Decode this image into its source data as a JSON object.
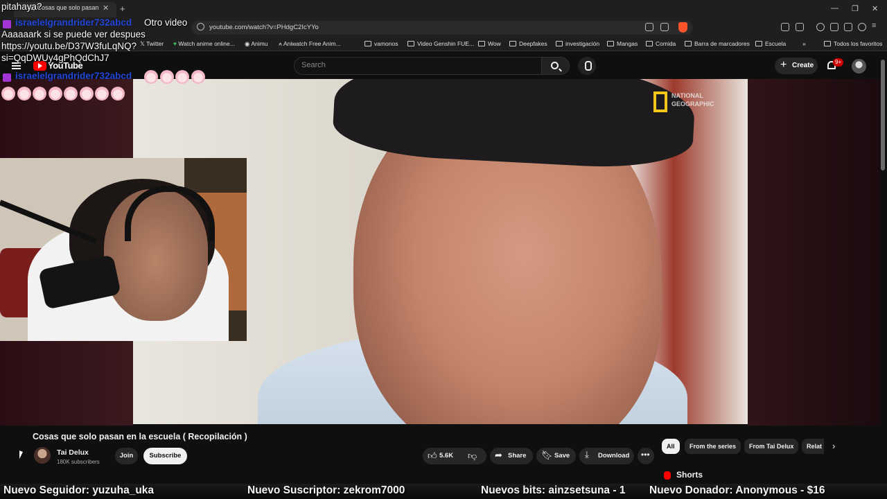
{
  "browser": {
    "tab_title": "(1) Cosas que solo pasan",
    "url": "youtube.com/watch?v=PHdgC2IcYYo",
    "bookmarks": [
      {
        "label": "Twitter",
        "icon": "x-icon"
      },
      {
        "label": "Watch anime online...",
        "icon": "heart-icon"
      },
      {
        "label": "Animu",
        "icon": "globe-icon"
      },
      {
        "label": "Aniwatch Free Anim...",
        "icon": "aniwatch-icon"
      },
      {
        "label": "vamonos",
        "icon": "folder-icon"
      },
      {
        "label": "Video Genshin FUE...",
        "icon": "folder-icon"
      },
      {
        "label": "Wow",
        "icon": "folder-icon"
      },
      {
        "label": "Deepfakes",
        "icon": "folder-icon"
      },
      {
        "label": "investigación",
        "icon": "folder-icon"
      },
      {
        "label": "Mangas",
        "icon": "folder-icon"
      },
      {
        "label": "Comida",
        "icon": "folder-icon"
      },
      {
        "label": "Barra de marcadores",
        "icon": "folder-icon"
      },
      {
        "label": "Escuela",
        "icon": "folder-icon"
      }
    ],
    "all_bookmarks": "Todos los favoritos"
  },
  "youtube": {
    "logo": "YouTube",
    "search_placeholder": "Search",
    "create_label": "Create",
    "notifications_badge": "9+",
    "video": {
      "watermark": "NATIONAL GEOGRAPHIC"
    },
    "title": "Cosas que solo pasan en la escuela ( Recopilación )",
    "channel": {
      "name": "Tai Delux",
      "subscribers": "180K subscribers",
      "join_label": "Join",
      "subscribe_label": "Subscribe"
    },
    "actions": {
      "likes": "5.6K",
      "share": "Share",
      "save": "Save",
      "download": "Download"
    },
    "chips": [
      "All",
      "From the series",
      "From Tai Delux",
      "Relat"
    ],
    "shorts_label": "Shorts"
  },
  "chat": {
    "line1": "pitahaya?",
    "user1": "israelelgrandrider732abcd",
    "msg1": "Otro video",
    "line2": "Aaaaaark si se puede ver despues",
    "line3": "https://youtu.be/D37W3fuLqNQ?",
    "line4": "si=QqDWUy4gPhQdChJ7",
    "user2": "israelelgrandrider732abcd"
  },
  "alerts": {
    "follower": "Nuevo Seguidor: yuzuha_uka",
    "subscriber": "Nuevo Suscriptor: zekrom7000",
    "bits": "Nuevos bits: ainzsetsuna - 1",
    "donor": "Nuevo Donador: Anonymous - $16"
  },
  "colors": {
    "youtube_red": "#ff0000",
    "chat_username": "#2347d8",
    "natgeo_yellow": "#f2c71a"
  }
}
